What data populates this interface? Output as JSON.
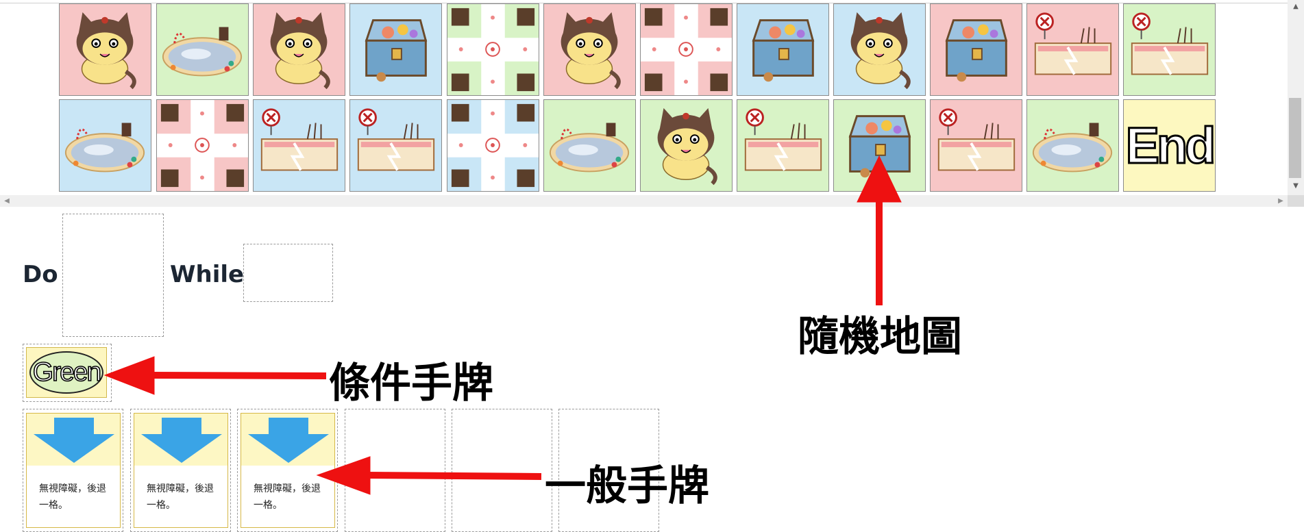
{
  "board": {
    "row1": [
      {
        "bg": "#f7c6c6",
        "icon": "cat-icon"
      },
      {
        "bg": "#d8f3c6",
        "icon": "chocolate-pool-icon"
      },
      {
        "bg": "#f7c6c6",
        "icon": "cat-icon"
      },
      {
        "bg": "#c9e6f6",
        "icon": "treasure-chest-icon"
      },
      {
        "bg": "#d8f3c6",
        "icon": "cross-path-icon"
      },
      {
        "bg": "#f7c6c6",
        "icon": "cat-icon"
      },
      {
        "bg": "#f7c6c6",
        "icon": "cross-path-icon"
      },
      {
        "bg": "#c9e6f6",
        "icon": "treasure-chest-icon"
      },
      {
        "bg": "#c9e6f6",
        "icon": "cat-icon"
      },
      {
        "bg": "#f7c6c6",
        "icon": "treasure-chest-icon"
      },
      {
        "bg": "#f7c6c6",
        "icon": "broken-fence-icon"
      },
      {
        "bg": "#d8f3c6",
        "icon": "broken-fence-icon"
      }
    ],
    "row2": [
      {
        "bg": "#c9e6f6",
        "icon": "chocolate-pool-icon"
      },
      {
        "bg": "#f7c6c6",
        "icon": "cross-path-icon"
      },
      {
        "bg": "#c9e6f6",
        "icon": "broken-fence-icon"
      },
      {
        "bg": "#c9e6f6",
        "icon": "broken-fence-icon"
      },
      {
        "bg": "#c9e6f6",
        "icon": "cross-path-icon"
      },
      {
        "bg": "#d8f3c6",
        "icon": "chocolate-pool-icon"
      },
      {
        "bg": "#d8f3c6",
        "icon": "cat-icon"
      },
      {
        "bg": "#d8f3c6",
        "icon": "broken-fence-icon"
      },
      {
        "bg": "#d8f3c6",
        "icon": "treasure-chest-icon"
      },
      {
        "bg": "#f7c6c6",
        "icon": "broken-fence-icon"
      },
      {
        "bg": "#d8f3c6",
        "icon": "chocolate-pool-icon"
      },
      {
        "bg": "#fdf8c0",
        "icon": "end-tile"
      }
    ],
    "end_label": "End"
  },
  "loop": {
    "do_label": "Do",
    "while_label": "While"
  },
  "condition_card": {
    "label": "Green",
    "fill": "#dff2c2"
  },
  "hand_cards": [
    {
      "text": "無視障礙，後退一格。",
      "icon": "down-arrow-icon",
      "arrow_color": "#3aa4e6"
    },
    {
      "text": "無視障礙，後退一格。",
      "icon": "down-arrow-icon",
      "arrow_color": "#3aa4e6"
    },
    {
      "text": "無視障礙，後退一格。",
      "icon": "down-arrow-icon",
      "arrow_color": "#3aa4e6"
    }
  ],
  "annotations": {
    "random_map": "隨機地圖",
    "condition_hand": "條件手牌",
    "general_hand": "一般手牌",
    "arrow_color": "#ee1111"
  }
}
